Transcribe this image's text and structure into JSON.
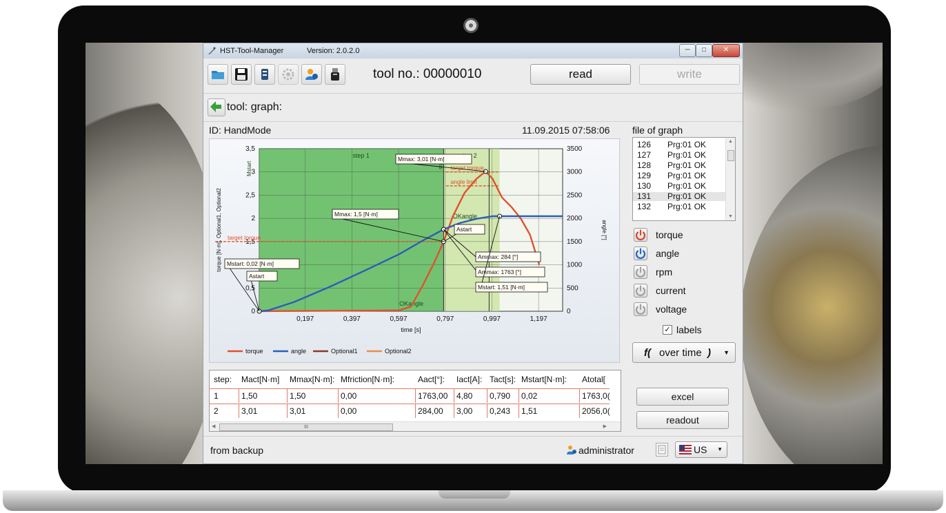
{
  "window": {
    "title": "HST-Tool-Manager",
    "version": "Version: 2.0.2.0"
  },
  "toolbar": {
    "tool_no": "tool no.: 00000010",
    "read_label": "read",
    "write_label": "write"
  },
  "nav": {
    "breadcrumb": "tool: graph:"
  },
  "graph_header": {
    "id": "ID: HandMode",
    "datetime": "11.09.2015  07:58:06"
  },
  "chart_data": {
    "type": "line",
    "xlabel": "time [s]",
    "ylabel": "torque [N·m], Optional1, Optional2",
    "y2label": "angle [°]",
    "xlim": [
      0,
      1.3
    ],
    "ylim": [
      0,
      3.5
    ],
    "y2lim": [
      0,
      3500
    ],
    "x_ticks": [
      "0,197",
      "0,397",
      "0,597",
      "0,797",
      "0,997",
      "1,197"
    ],
    "y_ticks": [
      "0",
      "0,5",
      "1",
      "1,5",
      "2",
      "2,5",
      "3",
      "3,5"
    ],
    "y2_ticks": [
      "0",
      "500",
      "1000",
      "1500",
      "2000",
      "2500",
      "3000",
      "3500"
    ],
    "legend": [
      "torque",
      "angle",
      "Optional1",
      "Optional2"
    ],
    "legend_position": "bottom",
    "grid": true,
    "series": [
      {
        "name": "torque",
        "color": "#e2502c",
        "axis": "y",
        "x": [
          0,
          0.6,
          0.65,
          0.7,
          0.75,
          0.79,
          0.83,
          0.88,
          0.93,
          0.97,
          1.0,
          1.04,
          1.08,
          1.12,
          1.16,
          1.2
        ],
        "y": [
          0,
          0.02,
          0.1,
          0.55,
          1.05,
          1.5,
          2.05,
          2.55,
          2.85,
          3.01,
          2.85,
          2.45,
          2.25,
          2.0,
          1.65,
          1.0
        ]
      },
      {
        "name": "angle",
        "color": "#2b5db8",
        "axis": "y2",
        "x": [
          0,
          0.04,
          0.15,
          0.3,
          0.45,
          0.6,
          0.7,
          0.79,
          0.86,
          0.93,
          1.0,
          1.05,
          1.3
        ],
        "y": [
          0,
          20,
          200,
          520,
          870,
          1230,
          1520,
          1763,
          1900,
          1990,
          2047,
          2047,
          2047
        ]
      }
    ],
    "regions": [
      {
        "label": "step 1",
        "x": [
          0,
          0.79
        ],
        "color": "#5cb85c"
      },
      {
        "label": "step 2",
        "x": [
          0.79,
          1.03
        ],
        "color": "#cfe6a8"
      }
    ],
    "reference_lines": [
      {
        "label": "target torque",
        "value": 1.5,
        "axis": "y"
      },
      {
        "label": "angle limit",
        "value": 2700,
        "axis": "y2"
      },
      {
        "label": "target torque",
        "value": 3.0,
        "axis": "y"
      }
    ],
    "annotations": [
      "Mstart",
      "start",
      "OKangle",
      "OKangle",
      "Mstart: 0,02 [N·m]",
      "Astart",
      "Mmax: 1,5 [N·m]",
      "Astart",
      "Mmax: 3,01 [N·m]",
      "Ammax: 284 [°]",
      "Ammax: 1763 [°]",
      "Mstart: 1,51 [N·m]"
    ]
  },
  "file_of_graph": {
    "title": "file of graph",
    "items": [
      {
        "num": "126",
        "status": "Prg:01 OK"
      },
      {
        "num": "127",
        "status": "Prg:01 OK"
      },
      {
        "num": "128",
        "status": "Prg:01 OK"
      },
      {
        "num": "129",
        "status": "Prg:01 OK"
      },
      {
        "num": "130",
        "status": "Prg:01 OK"
      },
      {
        "num": "131",
        "status": "Prg:01 OK"
      },
      {
        "num": "132",
        "status": "Prg:01 OK"
      }
    ]
  },
  "channels": [
    {
      "label": "torque",
      "color": "#d9452b",
      "on": true
    },
    {
      "label": "angle",
      "color": "#2563c5",
      "on": true
    },
    {
      "label": "rpm",
      "color": "#a0a0a0",
      "on": false
    },
    {
      "label": "current",
      "color": "#a0a0a0",
      "on": false
    },
    {
      "label": "voltage",
      "color": "#a0a0a0",
      "on": false
    }
  ],
  "labels_checkbox": {
    "label": "labels",
    "checked": true
  },
  "function_dropdown": {
    "prefix": "f(",
    "text": "over time",
    "suffix": ")"
  },
  "table": {
    "headers": [
      "step:",
      "Mact[N·m]",
      "Mmax[N·m]:",
      "Mfriction[N·m]:",
      "Aact[°]:",
      "Iact[A]:",
      "Tact[s]:",
      "Mstart[N·m]:",
      "Atotal["
    ],
    "rows": [
      [
        "1",
        "1,50",
        "1,50",
        "0,00",
        "1763,00",
        "4,80",
        "0,790",
        "0,02",
        "1763,0("
      ],
      [
        "2",
        "3,01",
        "3,01",
        "0,00",
        "284,00",
        "3,00",
        "0,243",
        "1,51",
        "2056,0("
      ]
    ],
    "scroll_mark": "III"
  },
  "buttons": {
    "excel": "excel",
    "readout": "readout"
  },
  "status": {
    "text": "from backup",
    "user": "administrator",
    "language": "US"
  }
}
